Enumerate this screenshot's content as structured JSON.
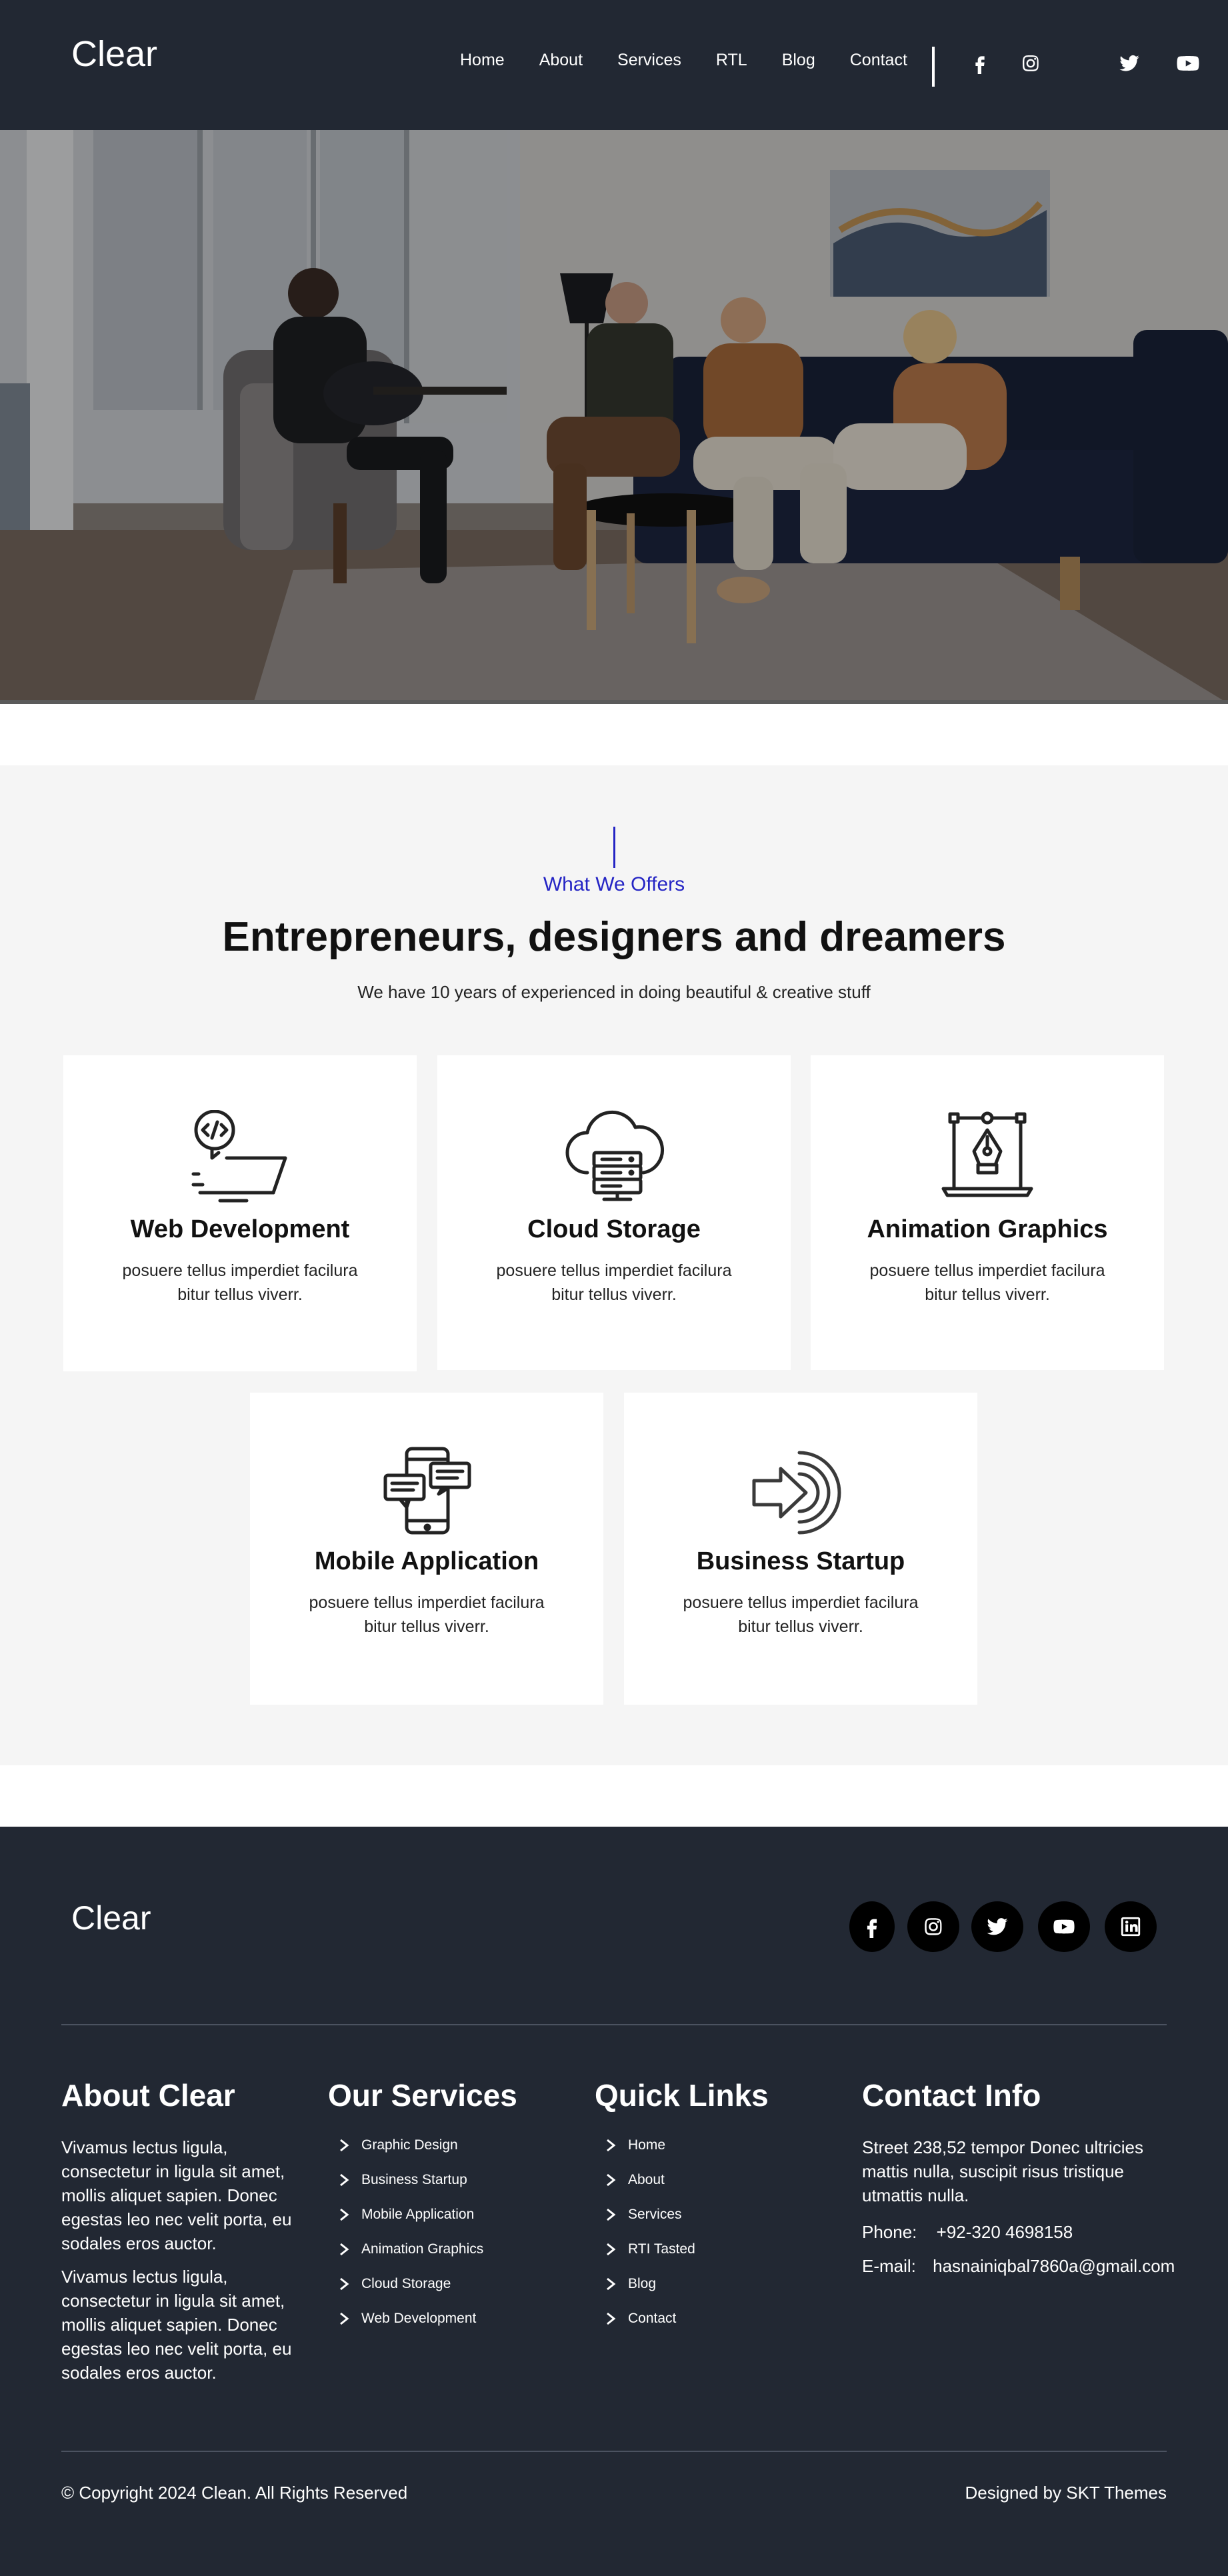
{
  "header": {
    "logo": "Clear",
    "nav": [
      "Home",
      "About",
      "Services",
      "RTL",
      "Blog",
      "Contact"
    ],
    "social": [
      "facebook-icon",
      "instagram-icon",
      "twitter-icon",
      "youtube-icon"
    ]
  },
  "hero": {
    "image": "people-playing-guitar-living-room-photo"
  },
  "offers": {
    "subtitle": "What We Offers",
    "title": "Entrepreneurs, designers and dreamers",
    "description": "We have 10 years of experienced in doing beautiful & creative stuff",
    "accent_color": "#2424c4",
    "cards": [
      {
        "title": "Web Development",
        "text": "posuere tellus imperdiet facilura bitur tellus viverr.",
        "icon": "laptop-code-icon"
      },
      {
        "title": "Cloud Storage",
        "text": "posuere tellus imperdiet facilura bitur tellus viverr.",
        "icon": "cloud-server-icon"
      },
      {
        "title": "Animation Graphics",
        "text": "posuere tellus imperdiet facilura bitur tellus viverr.",
        "icon": "pen-tool-icon"
      },
      {
        "title": "Mobile Application",
        "text": "posuere tellus imperdiet facilura bitur tellus viverr.",
        "icon": "mobile-chat-icon"
      },
      {
        "title": "Business Startup",
        "text": "posuere tellus imperdiet facilura bitur tellus viverr.",
        "icon": "arrow-target-icon"
      }
    ]
  },
  "footer": {
    "logo": "Clear",
    "social": [
      "facebook-icon",
      "instagram-icon",
      "twitter-icon",
      "youtube-icon",
      "linkedin-icon"
    ],
    "about": {
      "title": "About Clear",
      "para1": "Vivamus lectus ligula, consectetur in ligula sit amet, mollis aliquet sapien. Donec egestas leo nec velit porta, eu sodales eros auctor.",
      "para2": "Vivamus lectus ligula, consectetur in ligula sit amet, mollis aliquet sapien. Donec egestas leo nec velit porta, eu sodales eros auctor."
    },
    "services": {
      "title": "Our Services",
      "items": [
        "Graphic Design",
        "Business Startup",
        "Mobile Application",
        "Animation Graphics",
        "Cloud Storage",
        "Web Development"
      ]
    },
    "links": {
      "title": "Quick Links",
      "items": [
        "Home",
        "About",
        "Services",
        "RTI Tasted",
        "Blog",
        "Contact"
      ]
    },
    "contact": {
      "title": "Contact Info",
      "address": "Street 238,52 tempor Donec ultricies mattis nulla, suscipit risus tristique utmattis nulla.",
      "phone_label": "Phone:",
      "phone": "+92-320 4698158",
      "email_label": "E-mail:",
      "email": "hasnainiqbal7860a@gmail.com"
    },
    "copyright": "© Copyright 2024 Clean. All Rights Reserved",
    "designed_by": "Designed by SKT Themes"
  }
}
